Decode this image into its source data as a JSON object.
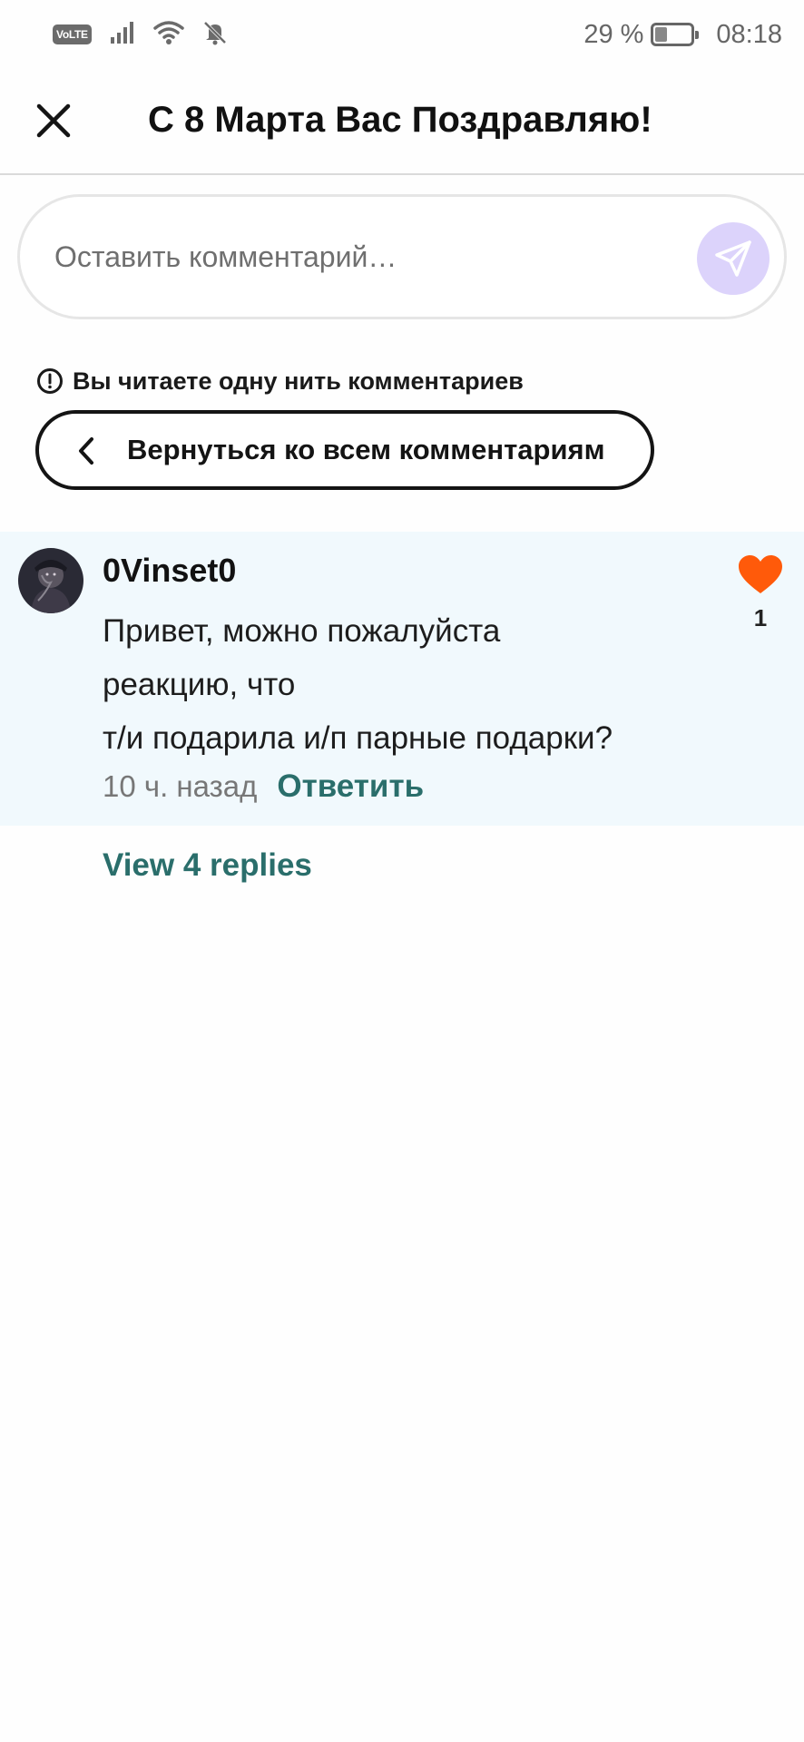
{
  "status_bar": {
    "network_badge": "VoLTE",
    "battery_percent": "29 %",
    "battery_level": 0.29,
    "time": "08:18",
    "icons": [
      "signal-icon",
      "wifi-icon",
      "bell-off-icon",
      "battery-icon"
    ]
  },
  "header": {
    "title": "С 8 Марта Вас Поздравляю!",
    "close_icon": "close-icon"
  },
  "composer": {
    "placeholder": "Оставить комментарий…",
    "send_icon": "send-icon",
    "send_color": "#dcd3fb"
  },
  "thread": {
    "notice": "Вы читаете одну нить комментариев",
    "back_label": "Вернуться ко всем комментариям"
  },
  "comment": {
    "username": "0Vinset0",
    "lines": [
      "Привет, можно пожалуйста",
      "реакцию, что",
      "т/и подарила и/п парные подарки?"
    ],
    "time_ago": "10 ч. назад",
    "reply_label": "Ответить",
    "likes": "1",
    "like_color": "#ff5a0a",
    "background": "#f1f9fd"
  },
  "view_replies": "View 4 replies",
  "colors": {
    "accent_teal": "#2a6e6b",
    "heart_orange": "#ff5a0a"
  }
}
